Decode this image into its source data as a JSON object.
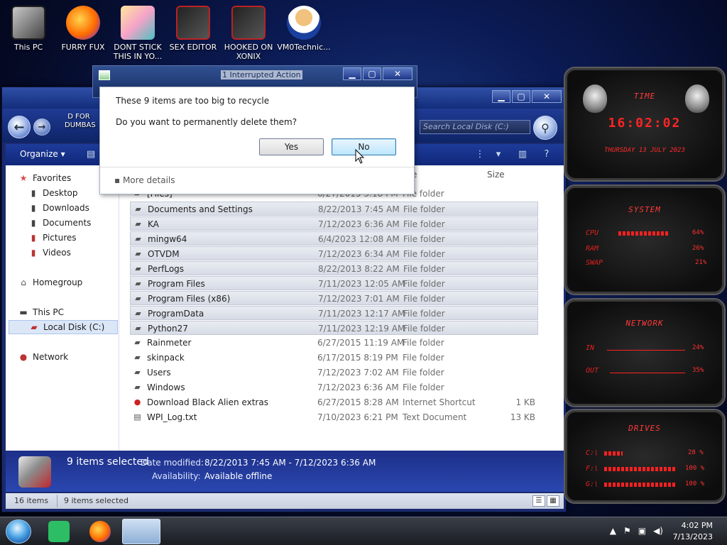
{
  "desktop": {
    "icons": [
      {
        "label": "This PC"
      },
      {
        "label": "FURRY FUX"
      },
      {
        "label": "DONT STICK THIS IN YO..."
      },
      {
        "label": "SEX EDITOR"
      },
      {
        "label": "HOOKED ON XONIX"
      },
      {
        "label": "VM0Technic..."
      }
    ],
    "partial_icon_label": "D FOR DUMBAS"
  },
  "background_window": {
    "title": "1 Interrupted Action"
  },
  "dialog": {
    "message": "These 9 items are too big to recycle",
    "question": "Do you want to permanently delete them?",
    "yes_label": "Yes",
    "no_label": "No",
    "more_details": "More details"
  },
  "explorer": {
    "search_placeholder": "Search Local Disk (C:)",
    "organize_label": "Organize",
    "nav": {
      "favorites": "Favorites",
      "desktop": "Desktop",
      "downloads": "Downloads",
      "documents": "Documents",
      "pictures": "Pictures",
      "videos": "Videos",
      "homegroup": "Homegroup",
      "this_pc": "This PC",
      "local_disk": "Local Disk (C:)",
      "network": "Network"
    },
    "columns": {
      "type_partial": "e",
      "size": "Size"
    },
    "rows": [
      {
        "name": "[Files]",
        "date": "6/27/2015 3:18 PM",
        "type": "File folder",
        "size": "",
        "selected": false
      },
      {
        "name": "Documents and Settings",
        "date": "8/22/2013 7:45 AM",
        "type": "File folder",
        "size": "",
        "selected": true
      },
      {
        "name": "KA",
        "date": "7/12/2023 6:36 AM",
        "type": "File folder",
        "size": "",
        "selected": true
      },
      {
        "name": "mingw64",
        "date": "6/4/2023 12:08 AM",
        "type": "File folder",
        "size": "",
        "selected": true
      },
      {
        "name": "OTVDM",
        "date": "7/12/2023 6:34 AM",
        "type": "File folder",
        "size": "",
        "selected": true
      },
      {
        "name": "PerfLogs",
        "date": "8/22/2013 8:22 AM",
        "type": "File folder",
        "size": "",
        "selected": true
      },
      {
        "name": "Program Files",
        "date": "7/11/2023 12:05 AM",
        "type": "File folder",
        "size": "",
        "selected": true
      },
      {
        "name": "Program Files (x86)",
        "date": "7/12/2023 7:01 AM",
        "type": "File folder",
        "size": "",
        "selected": true
      },
      {
        "name": "ProgramData",
        "date": "7/11/2023 12:17 AM",
        "type": "File folder",
        "size": "",
        "selected": true
      },
      {
        "name": "Python27",
        "date": "7/11/2023 12:19 AM",
        "type": "File folder",
        "size": "",
        "selected": true
      },
      {
        "name": "Rainmeter",
        "date": "6/27/2015 11:19 AM",
        "type": "File folder",
        "size": "",
        "selected": false
      },
      {
        "name": "skinpack",
        "date": "6/17/2015 8:19 PM",
        "type": "File folder",
        "size": "",
        "selected": false
      },
      {
        "name": "Users",
        "date": "7/12/2023 7:02 AM",
        "type": "File folder",
        "size": "",
        "selected": false
      },
      {
        "name": "Windows",
        "date": "7/12/2023 6:36 AM",
        "type": "File folder",
        "size": "",
        "selected": false
      },
      {
        "name": "Download Black Alien extras",
        "date": "6/27/2015 8:28 AM",
        "type": "Internet Shortcut",
        "size": "1 KB",
        "selected": false
      },
      {
        "name": "WPI_Log.txt",
        "date": "7/10/2023 6:21 PM",
        "type": "Text Document",
        "size": "13 KB",
        "selected": false
      }
    ],
    "details": {
      "count": "9 items selected",
      "date_label": "Date modified:",
      "date_value": "8/22/2013 7:45 AM - 7/12/2023 6:36 AM",
      "avail_label": "Availability:",
      "avail_value": "Available offline"
    },
    "status": {
      "items": "16 items",
      "selected": "9 items selected"
    }
  },
  "widgets": {
    "time": {
      "title": "TIME",
      "clock": "16:02:02",
      "date": "THURSDAY 13 JULY 2023"
    },
    "system": {
      "title": "SYSTEM",
      "cpu_label": "CPU",
      "cpu_val": "64%",
      "ram_label": "RAM",
      "ram_val": "26%",
      "swap_label": "SWAP",
      "swap_val": "21%"
    },
    "network": {
      "title": "NETWORK",
      "in_label": "IN",
      "in_val": "24%",
      "out_label": "OUT",
      "out_val": "35%"
    },
    "drives": {
      "title": "DRIVES",
      "d1_label": "C:\\",
      "d1_val": "28 %",
      "d2_label": "F:\\",
      "d2_val": "100 %",
      "d3_label": "G:\\",
      "d3_val": "100 %"
    }
  },
  "taskbar": {
    "time": "4:02 PM",
    "date": "7/13/2023"
  },
  "colors": {
    "accent_red": "#ff2a2a",
    "explorer_blue": "#1d3b9a",
    "dialog_no_focus": "#bde6fd"
  }
}
